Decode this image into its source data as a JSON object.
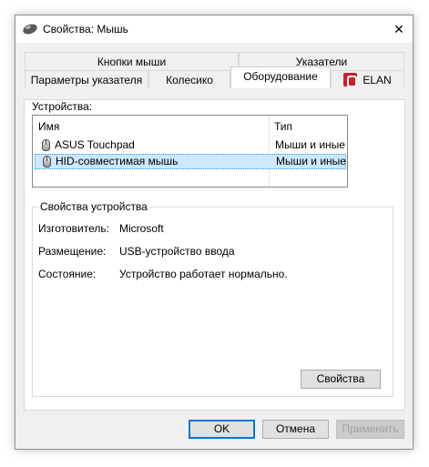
{
  "window": {
    "title": "Свойства: Мышь",
    "close_glyph": "✕"
  },
  "tabs": {
    "row1": [
      "Кнопки мыши",
      "Указатели"
    ],
    "row2": [
      "Параметры указателя",
      "Колесико",
      "Оборудование",
      "ELAN"
    ],
    "active": "Оборудование"
  },
  "devices": {
    "label": "Устройства:",
    "columns": [
      "Имя",
      "Тип"
    ],
    "rows": [
      {
        "name": "ASUS Touchpad",
        "type": "Мыши и иные...",
        "selected": false
      },
      {
        "name": "HID-совместимая мышь",
        "type": "Мыши и иные...",
        "selected": true
      }
    ]
  },
  "device_props": {
    "legend": "Свойства устройства",
    "manufacturer_label": "Изготовитель:",
    "manufacturer_value": "Microsoft",
    "location_label": "Размещение:",
    "location_value": "USB-устройство ввода",
    "status_label": "Состояние:",
    "status_value": "Устройство работает нормально.",
    "properties_button": "Свойства"
  },
  "footer": {
    "ok": "OK",
    "cancel": "Отмена",
    "apply": "Применить"
  },
  "colors": {
    "selection": "#cce8ff",
    "focus_border": "#0078d7",
    "elan_brand": "#cc1f2d"
  }
}
